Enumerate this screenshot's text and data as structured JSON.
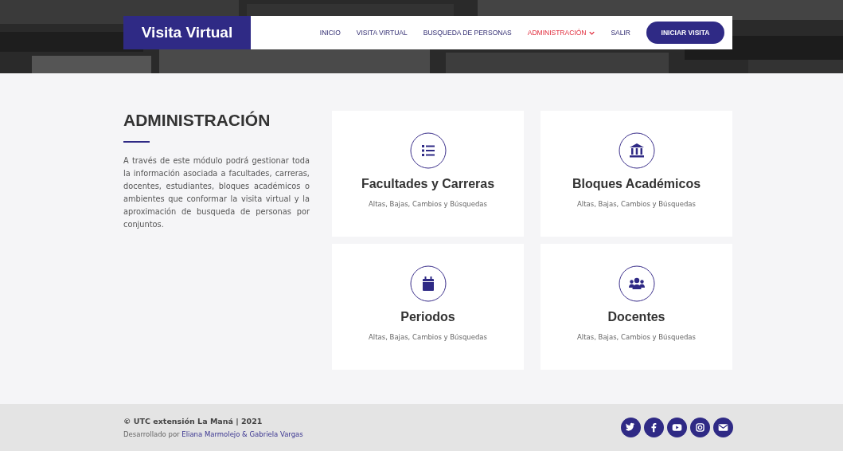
{
  "header": {
    "brand": "Visita Virtual",
    "nav": [
      {
        "label": "INICIO",
        "selected": false,
        "dropdown": false
      },
      {
        "label": "VISITA VIRTUAL",
        "selected": false,
        "dropdown": false
      },
      {
        "label": "BUSQUEDA DE PERSONAS",
        "selected": false,
        "dropdown": false
      },
      {
        "label": "ADMINISTRACIÓN",
        "selected": true,
        "dropdown": true
      },
      {
        "label": "SALIR",
        "selected": false,
        "dropdown": false
      }
    ],
    "cta": "INICIAR VISITA"
  },
  "intro": {
    "title": "ADMINISTRACIÓN",
    "text": "A través de este módulo podrá gestionar toda la información asociada a facultades, carreras, docentes, estudiantes, bloques académicos o ambientes que conformar la visita virtual y la aproximación de busqueda de personas por conjuntos."
  },
  "cards": [
    {
      "kind": "list",
      "title": "Facultades y Carreras",
      "subtitle": "Altas, Bajas, Cambios y Búsquedas"
    },
    {
      "kind": "building",
      "title": "Bloques Académicos",
      "subtitle": "Altas, Bajas, Cambios y Búsquedas"
    },
    {
      "kind": "calendar",
      "title": "Periodos",
      "subtitle": "Altas, Bajas, Cambios y Búsquedas"
    },
    {
      "kind": "users",
      "title": "Docentes",
      "subtitle": "Altas, Bajas, Cambios y Búsquedas"
    }
  ],
  "footer": {
    "copyright": "© UTC extensión La Maná | 2021",
    "credit_prefix": "Desarrollado por",
    "credit_link": "Eliana Marmolejo & Gabriela Vargas",
    "social": [
      {
        "kind": "twitter"
      },
      {
        "kind": "facebook"
      },
      {
        "kind": "youtube"
      },
      {
        "kind": "instagram"
      },
      {
        "kind": "email"
      }
    ]
  }
}
